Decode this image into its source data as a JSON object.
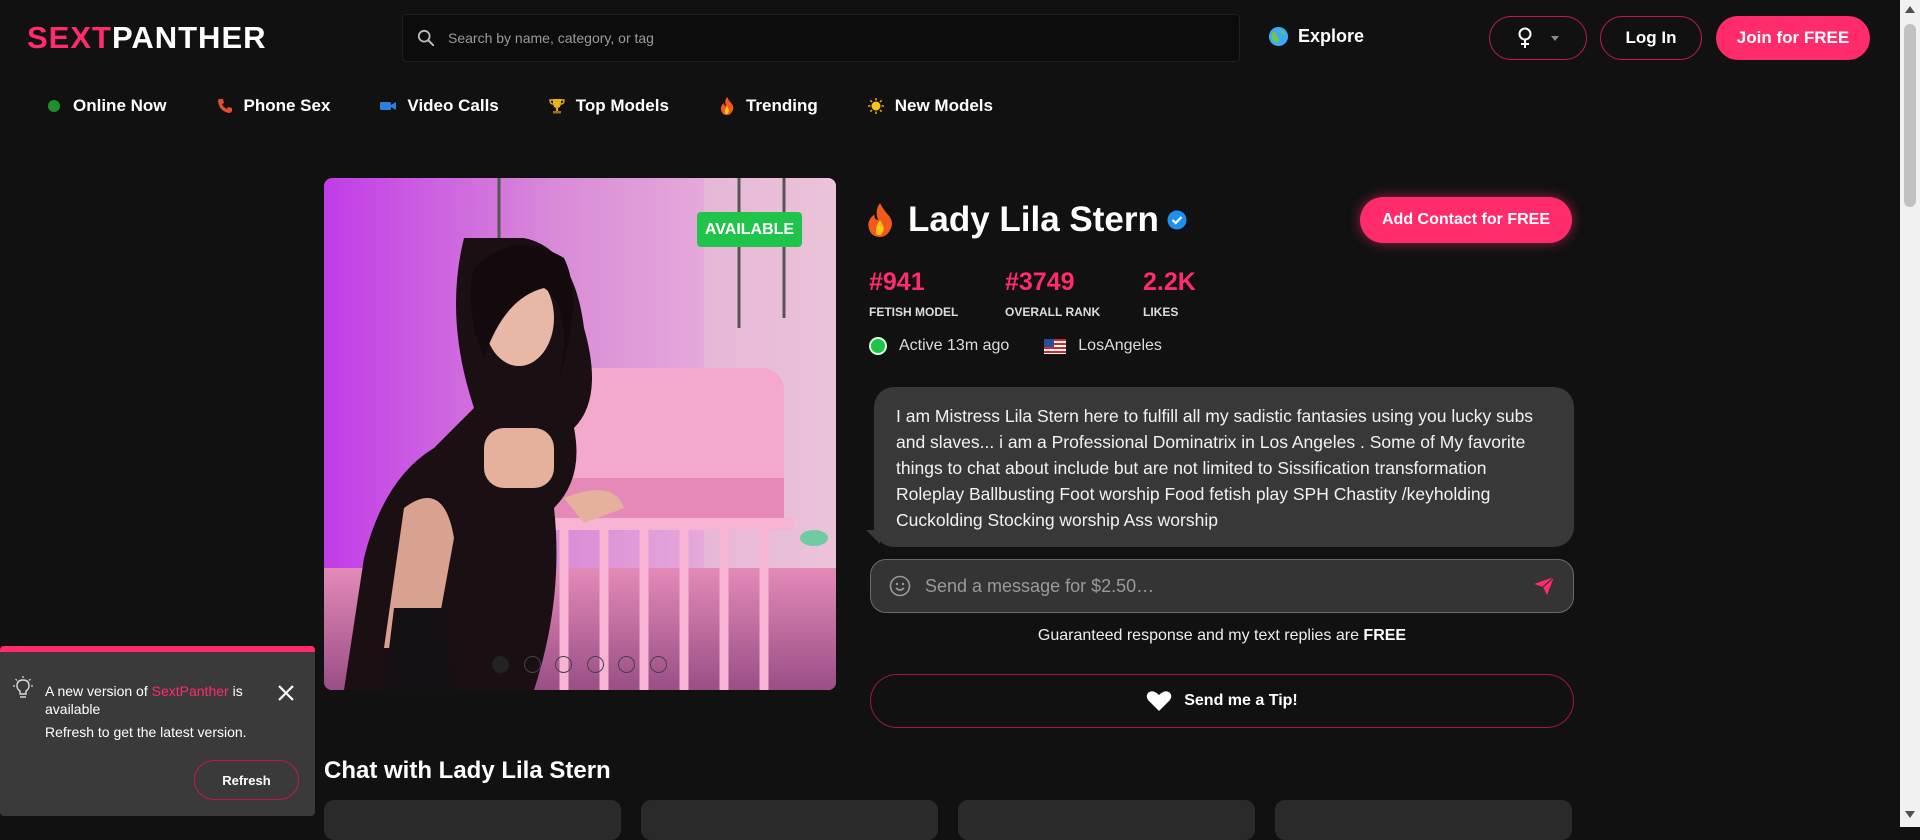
{
  "header": {
    "logo_part1": "SEXT",
    "logo_part2": "PANTHER",
    "search_placeholder": "Search by name, category, or tag",
    "explore_label": "Explore",
    "login_label": "Log In",
    "join_label": "Join for FREE"
  },
  "nav": {
    "items": [
      {
        "label": "Online Now",
        "icon": "green-dot-icon"
      },
      {
        "label": "Phone Sex",
        "icon": "phone-icon"
      },
      {
        "label": "Video Calls",
        "icon": "video-camera-icon"
      },
      {
        "label": "Top Models",
        "icon": "trophy-icon"
      },
      {
        "label": "Trending",
        "icon": "fire-icon"
      },
      {
        "label": "New Models",
        "icon": "sun-icon"
      }
    ]
  },
  "profile": {
    "status_badge": "AVAILABLE",
    "name": "Lady Lila Stern",
    "add_contact_label": "Add Contact for FREE",
    "stats": [
      {
        "value": "#941",
        "label": "FETISH MODEL"
      },
      {
        "value": "#3749",
        "label": "OVERALL RANK"
      },
      {
        "value": "2.2K",
        "label": "LIKES"
      }
    ],
    "active_text": "Active 13m ago",
    "location": "LosAngeles",
    "bio": "I am Mistress Lila Stern here to fulfill all my sadistic fantasies using you lucky subs and slaves... i am a Professional Dominatrix in Los Angeles . Some of My favorite things to chat about include but are not limited to Sissification transformation Roleplay Ballbusting Foot worship Food fetish play SPH Chastity /keyholding Cuckolding Stocking worship Ass worship",
    "message_placeholder": "Send a message for $2.50…",
    "guaranteed_text": "Guaranteed response and my text replies are",
    "guaranteed_bold": "FREE",
    "tip_label": "Send me a Tip!",
    "photo_count": 6,
    "active_photo_index": 1
  },
  "chat_section": {
    "title": "Chat with Lady Lila Stern"
  },
  "toast": {
    "text_prefix": "A new version of",
    "brand": "SextPanther",
    "text_suffix": "is available",
    "subtext": "Refresh to get the latest version.",
    "refresh_label": "Refresh"
  },
  "colors": {
    "accent": "#ff2b6b",
    "background": "#111111",
    "available": "#21c44a"
  }
}
